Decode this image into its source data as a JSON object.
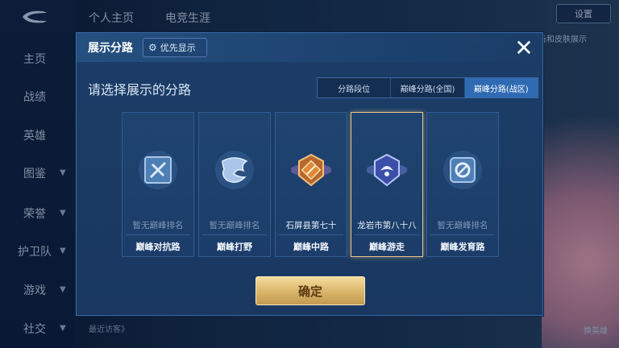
{
  "top_tabs": [
    "个人主页",
    "电竞生涯"
  ],
  "sidebar": {
    "items": [
      {
        "label": "主页",
        "has_chevron": false
      },
      {
        "label": "战绩",
        "has_chevron": false
      },
      {
        "label": "英雄",
        "has_chevron": false
      },
      {
        "label": "图鉴",
        "has_chevron": true
      },
      {
        "label": "荣誉",
        "has_chevron": true
      },
      {
        "label": "护卫队",
        "has_chevron": true
      },
      {
        "label": "游戏",
        "has_chevron": true
      },
      {
        "label": "社交",
        "has_chevron": true
      }
    ]
  },
  "right_panel": {
    "button_label": "设置",
    "fragment": "备和皮肤展示",
    "side_label": "换英雄"
  },
  "recent_visitors": "最近访客》",
  "dialog": {
    "title": "展示分路",
    "priority_button": "优先显示",
    "subtitle": "请选择展示的分路",
    "segments": [
      {
        "label": "分路段位",
        "active": false
      },
      {
        "label": "巅峰分路(全国)",
        "active": false
      },
      {
        "label": "巅峰分路(战区)",
        "active": true
      }
    ],
    "cards": [
      {
        "rank": "暂无巅峰排名",
        "position": "巅峰对抗路",
        "icon": "sword-shield-icon",
        "selected": false
      },
      {
        "rank": "暂无巅峰排名",
        "position": "巅峰打野",
        "icon": "dragon-icon",
        "selected": false
      },
      {
        "rank": "石屏县第七十",
        "position": "巅峰中路",
        "icon": "mid-lane-emblem-icon",
        "selected": false
      },
      {
        "rank": "龙岩市第八十八",
        "position": "巅峰游走",
        "icon": "roam-emblem-icon",
        "selected": true
      },
      {
        "rank": "暂无巅峰排名",
        "position": "巅峰发育路",
        "icon": "marksman-icon",
        "selected": false
      }
    ],
    "confirm_label": "确定"
  },
  "colors": {
    "accent_blue": "#2f6bb3",
    "gold": "#d9b46a",
    "selected_border": "#e9c88a"
  }
}
